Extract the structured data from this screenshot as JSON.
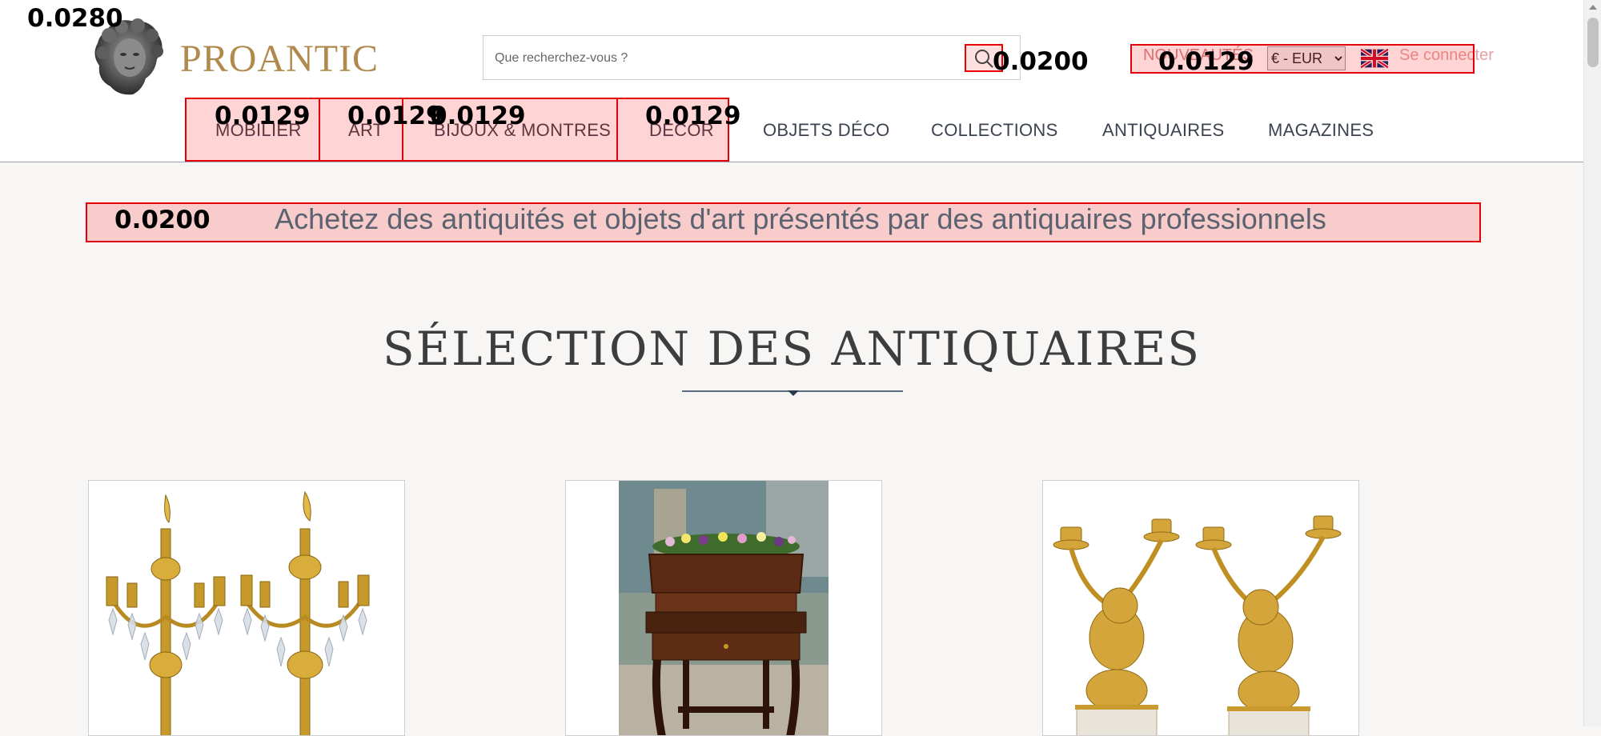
{
  "header": {
    "logo_text": "PROANTIC",
    "search_placeholder": "Que recherchez-vous ?",
    "nouveautes_label": "NOUVEAUTÉS",
    "currency_value": "€ - EUR",
    "login_label": "Se connecter"
  },
  "nav": {
    "items": [
      "MOBILIER",
      "ART",
      "BIJOUX & MONTRES",
      "DÉCOR",
      "OBJETS DÉCO",
      "COLLECTIONS",
      "ANTIQUAIRES",
      "MAGAZINES"
    ]
  },
  "tagline": "Achetez des antiquités et objets d'art présentés par des antiquaires professionnels",
  "section_title": "SÉLECTION DES ANTIQUAIRES",
  "overlay_scores": {
    "logo": "0.0280",
    "search_button": "0.0200",
    "header_right": "0.0129",
    "nav_mobilier": "0.0129",
    "nav_art": "0.0129",
    "nav_bijoux": "0.0129",
    "nav_decor": "0.0129",
    "tagline": "0.0200"
  },
  "colors": {
    "brand_gold": "#b08a4d",
    "nav_text": "#3c4350",
    "highlight": "#e3000b",
    "background": "#f7f6f4"
  },
  "icons": [
    "logo-bust-icon",
    "search-icon",
    "uk-flag-icon"
  ]
}
